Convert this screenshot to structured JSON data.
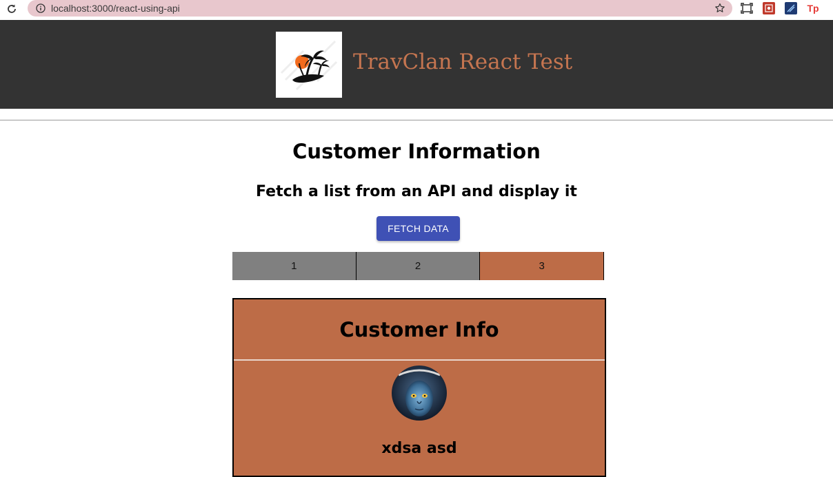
{
  "browser": {
    "url": "localhost:3000/react-using-api",
    "extensions": {
      "tp_label": "Tp"
    }
  },
  "header": {
    "title": "TravClan React Test",
    "title_color": "#c57550",
    "background": "#333333",
    "logo_icon": "palm-island-sunset-logo"
  },
  "main": {
    "title": "Customer Information",
    "subtitle": "Fetch a list from an API and display it",
    "fetch_button_label": "FETCH DATA",
    "fetch_button_color": "#3f51b5",
    "pages": [
      {
        "label": "1",
        "active": false
      },
      {
        "label": "2",
        "active": false
      },
      {
        "label": "3",
        "active": true
      }
    ],
    "active_page_color": "#bd6c47",
    "inactive_page_color": "#808080"
  },
  "card": {
    "title": "Customer Info",
    "avatar_icon": "avatar-na-vi-portrait",
    "name": "xdsa asd",
    "background": "#bd6c47"
  }
}
